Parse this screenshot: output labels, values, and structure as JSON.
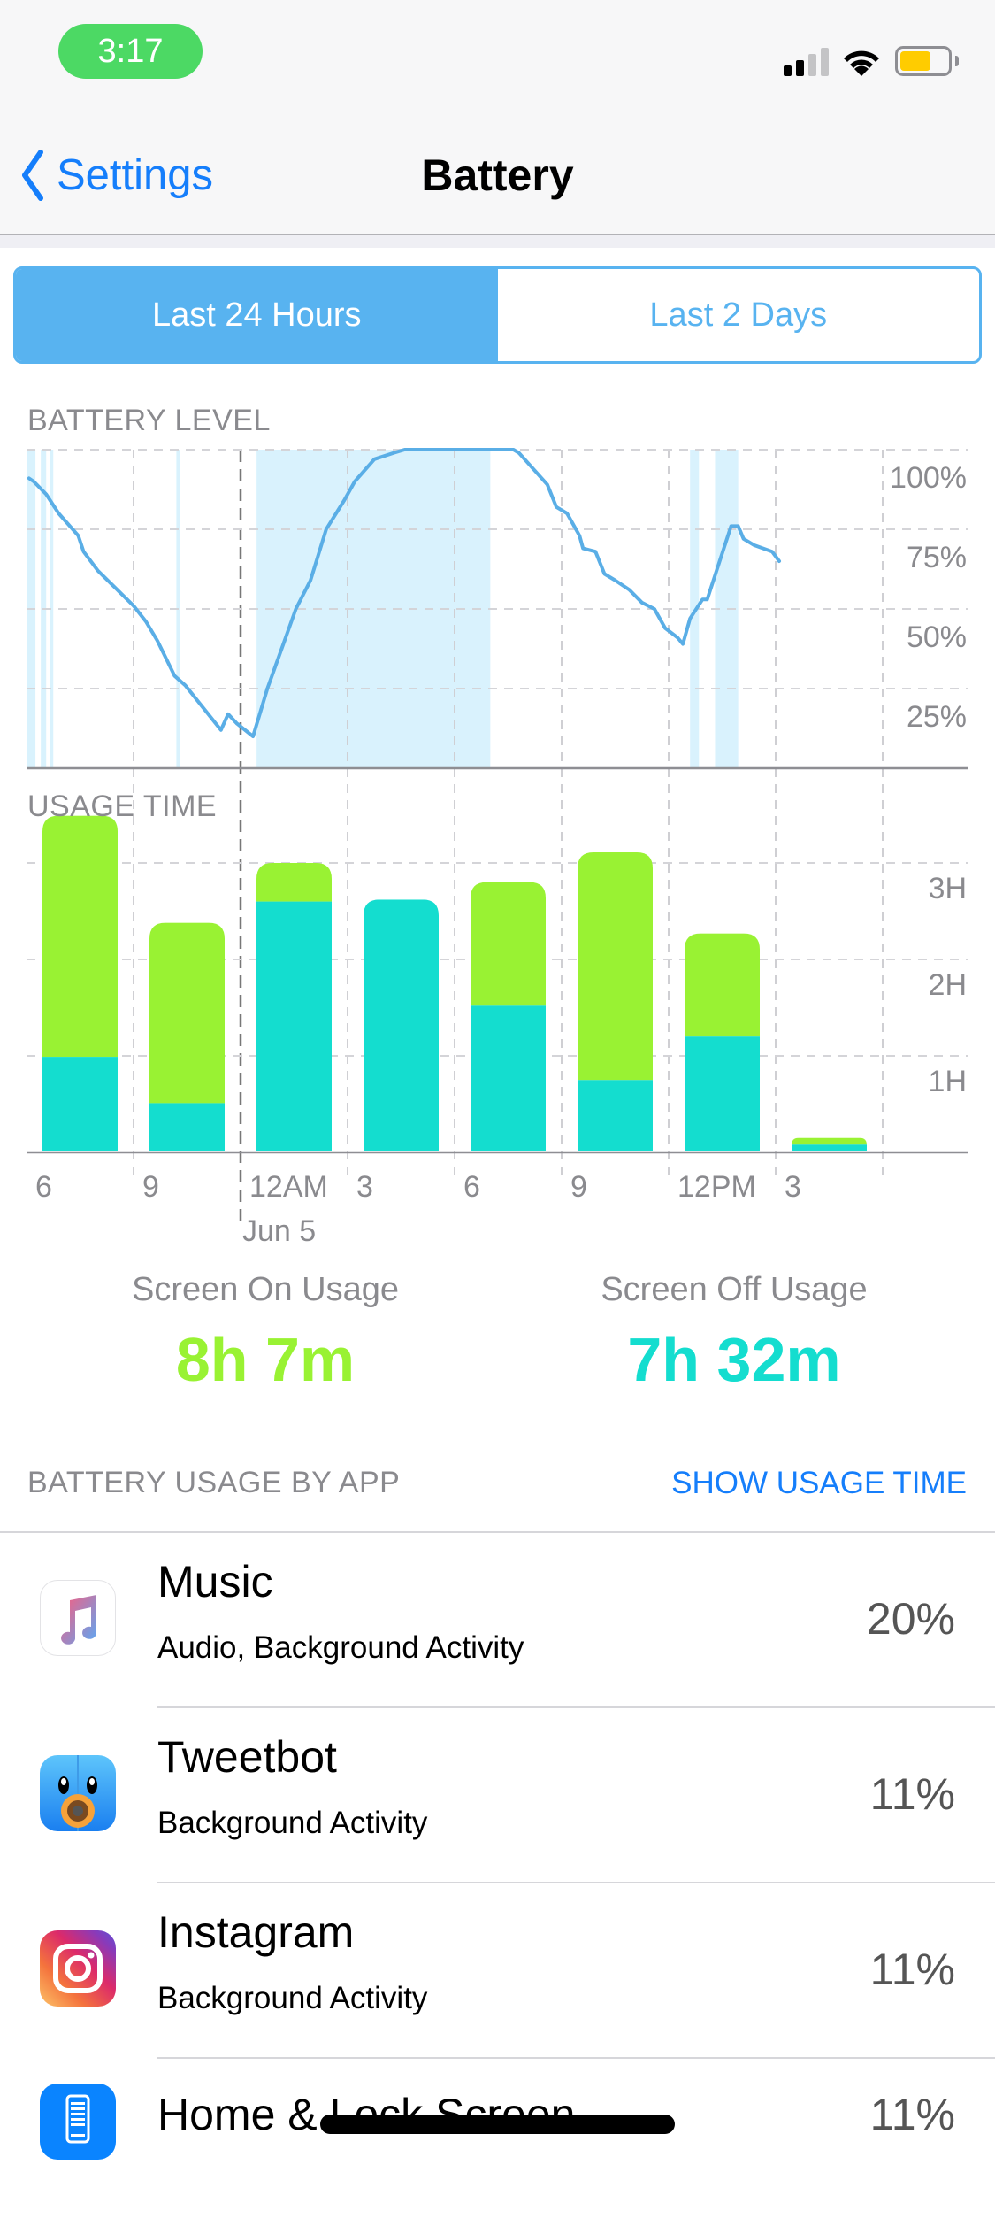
{
  "status_bar": {
    "time": "3:17",
    "signal_bars_active": 2,
    "signal_bars_total": 4,
    "battery_level_fraction": 0.65,
    "battery_color": "#ffcc00",
    "low_power_mode": true,
    "icons": [
      "cellular-signal-icon",
      "wifi-icon",
      "battery-icon"
    ]
  },
  "nav": {
    "back_label": "Settings",
    "title": "Battery",
    "back_icon": "chevron-left-icon"
  },
  "segmented": {
    "options": [
      "Last 24 Hours",
      "Last 2 Days"
    ],
    "selected": 0
  },
  "colors": {
    "accent_blue": "#157efb",
    "segment_blue": "#58b3f0",
    "battery_line": "#5aaee6",
    "charging_band": "#d9f2fd",
    "screen_on": "#99f233",
    "screen_off": "#14ddcf"
  },
  "chart_data": [
    {
      "type": "line",
      "title": "BATTERY LEVEL",
      "xlabel": "",
      "ylabel": "",
      "x_unit": "hours since 6 PM (Jun 4)",
      "xlim": [
        0,
        24
      ],
      "ylim": [
        0,
        100
      ],
      "y_ticks": [
        25,
        50,
        75,
        100
      ],
      "y_tick_labels": [
        "25%",
        "50%",
        "75%",
        "100%"
      ],
      "grid": true,
      "midnight_marker_hour": 6,
      "charging_periods": [
        [
          0.0,
          0.25
        ],
        [
          0.4,
          0.55
        ],
        [
          0.65,
          0.75
        ],
        [
          4.2,
          4.3
        ],
        [
          6.45,
          13.0
        ],
        [
          18.6,
          18.85
        ],
        [
          19.3,
          19.95
        ]
      ],
      "series": [
        {
          "name": "Battery Level",
          "x": [
            0.07,
            0.2,
            0.55,
            0.9,
            1.45,
            1.6,
            2.0,
            3.0,
            3.35,
            3.67,
            4.15,
            4.45,
            5.45,
            5.65,
            5.9,
            6.35,
            6.75,
            7.2,
            7.55,
            7.96,
            8.4,
            8.9,
            9.2,
            9.75,
            10.3,
            10.6,
            13.65,
            13.8,
            14.6,
            14.85,
            15.15,
            15.5,
            15.6,
            15.95,
            16.2,
            16.5,
            16.9,
            17.25,
            17.6,
            17.9,
            18.25,
            18.4,
            18.6,
            18.95,
            19.08,
            19.75,
            19.95,
            20.1,
            20.4,
            20.9,
            21.1
          ],
          "values": [
            91,
            90,
            86,
            80,
            73,
            68,
            62,
            51,
            46,
            40,
            29,
            26,
            12,
            17,
            14,
            10,
            25,
            39,
            50,
            59,
            75,
            84,
            90,
            97,
            99,
            100,
            100,
            99,
            89,
            82,
            80,
            73,
            69,
            68,
            61,
            59,
            56,
            52,
            50,
            44,
            41,
            39,
            47,
            53,
            53,
            76,
            76,
            72,
            70,
            68,
            65
          ]
        }
      ]
    },
    {
      "type": "bar",
      "stacked": true,
      "title": "USAGE TIME",
      "xlabel": "",
      "ylabel": "",
      "ylim": [
        0,
        3.6
      ],
      "y_ticks": [
        1,
        2,
        3
      ],
      "y_tick_labels": [
        "1H",
        "2H",
        "3H"
      ],
      "grid": true,
      "categories": [
        "6",
        "9",
        "12AM",
        "3",
        "6",
        "9",
        "12PM",
        "3"
      ],
      "date_label": "Jun 5",
      "date_label_category": 2,
      "series": [
        {
          "name": "Screen Off",
          "color_key": "screen_off",
          "values": [
            0.99,
            0.51,
            2.6,
            2.62,
            1.52,
            0.75,
            1.2,
            0.08
          ]
        },
        {
          "name": "Screen On",
          "color_key": "screen_on",
          "values": [
            2.5,
            1.87,
            0.4,
            0.0,
            1.28,
            2.36,
            1.07,
            0.07
          ]
        }
      ]
    }
  ],
  "labels": {
    "battery_level": "BATTERY LEVEL",
    "usage_time": "USAGE TIME"
  },
  "summary": {
    "screen_on_label": "Screen On Usage",
    "screen_on_value": "8h 7m",
    "screen_off_label": "Screen Off Usage",
    "screen_off_value": "7h 32m"
  },
  "app_section": {
    "header": "BATTERY USAGE BY APP",
    "toggle_label": "SHOW USAGE TIME",
    "apps": [
      {
        "name": "Music",
        "detail": "Audio, Background Activity",
        "percent": "20%",
        "icon": "music-app-icon"
      },
      {
        "name": "Tweetbot",
        "detail": "Background Activity",
        "percent": "11%",
        "icon": "tweetbot-app-icon"
      },
      {
        "name": "Instagram",
        "detail": "Background Activity",
        "percent": "11%",
        "icon": "instagram-app-icon"
      },
      {
        "name": "Home & Lock Screen",
        "detail": "",
        "percent": "11%",
        "icon": "home-lock-screen-icon"
      }
    ]
  }
}
